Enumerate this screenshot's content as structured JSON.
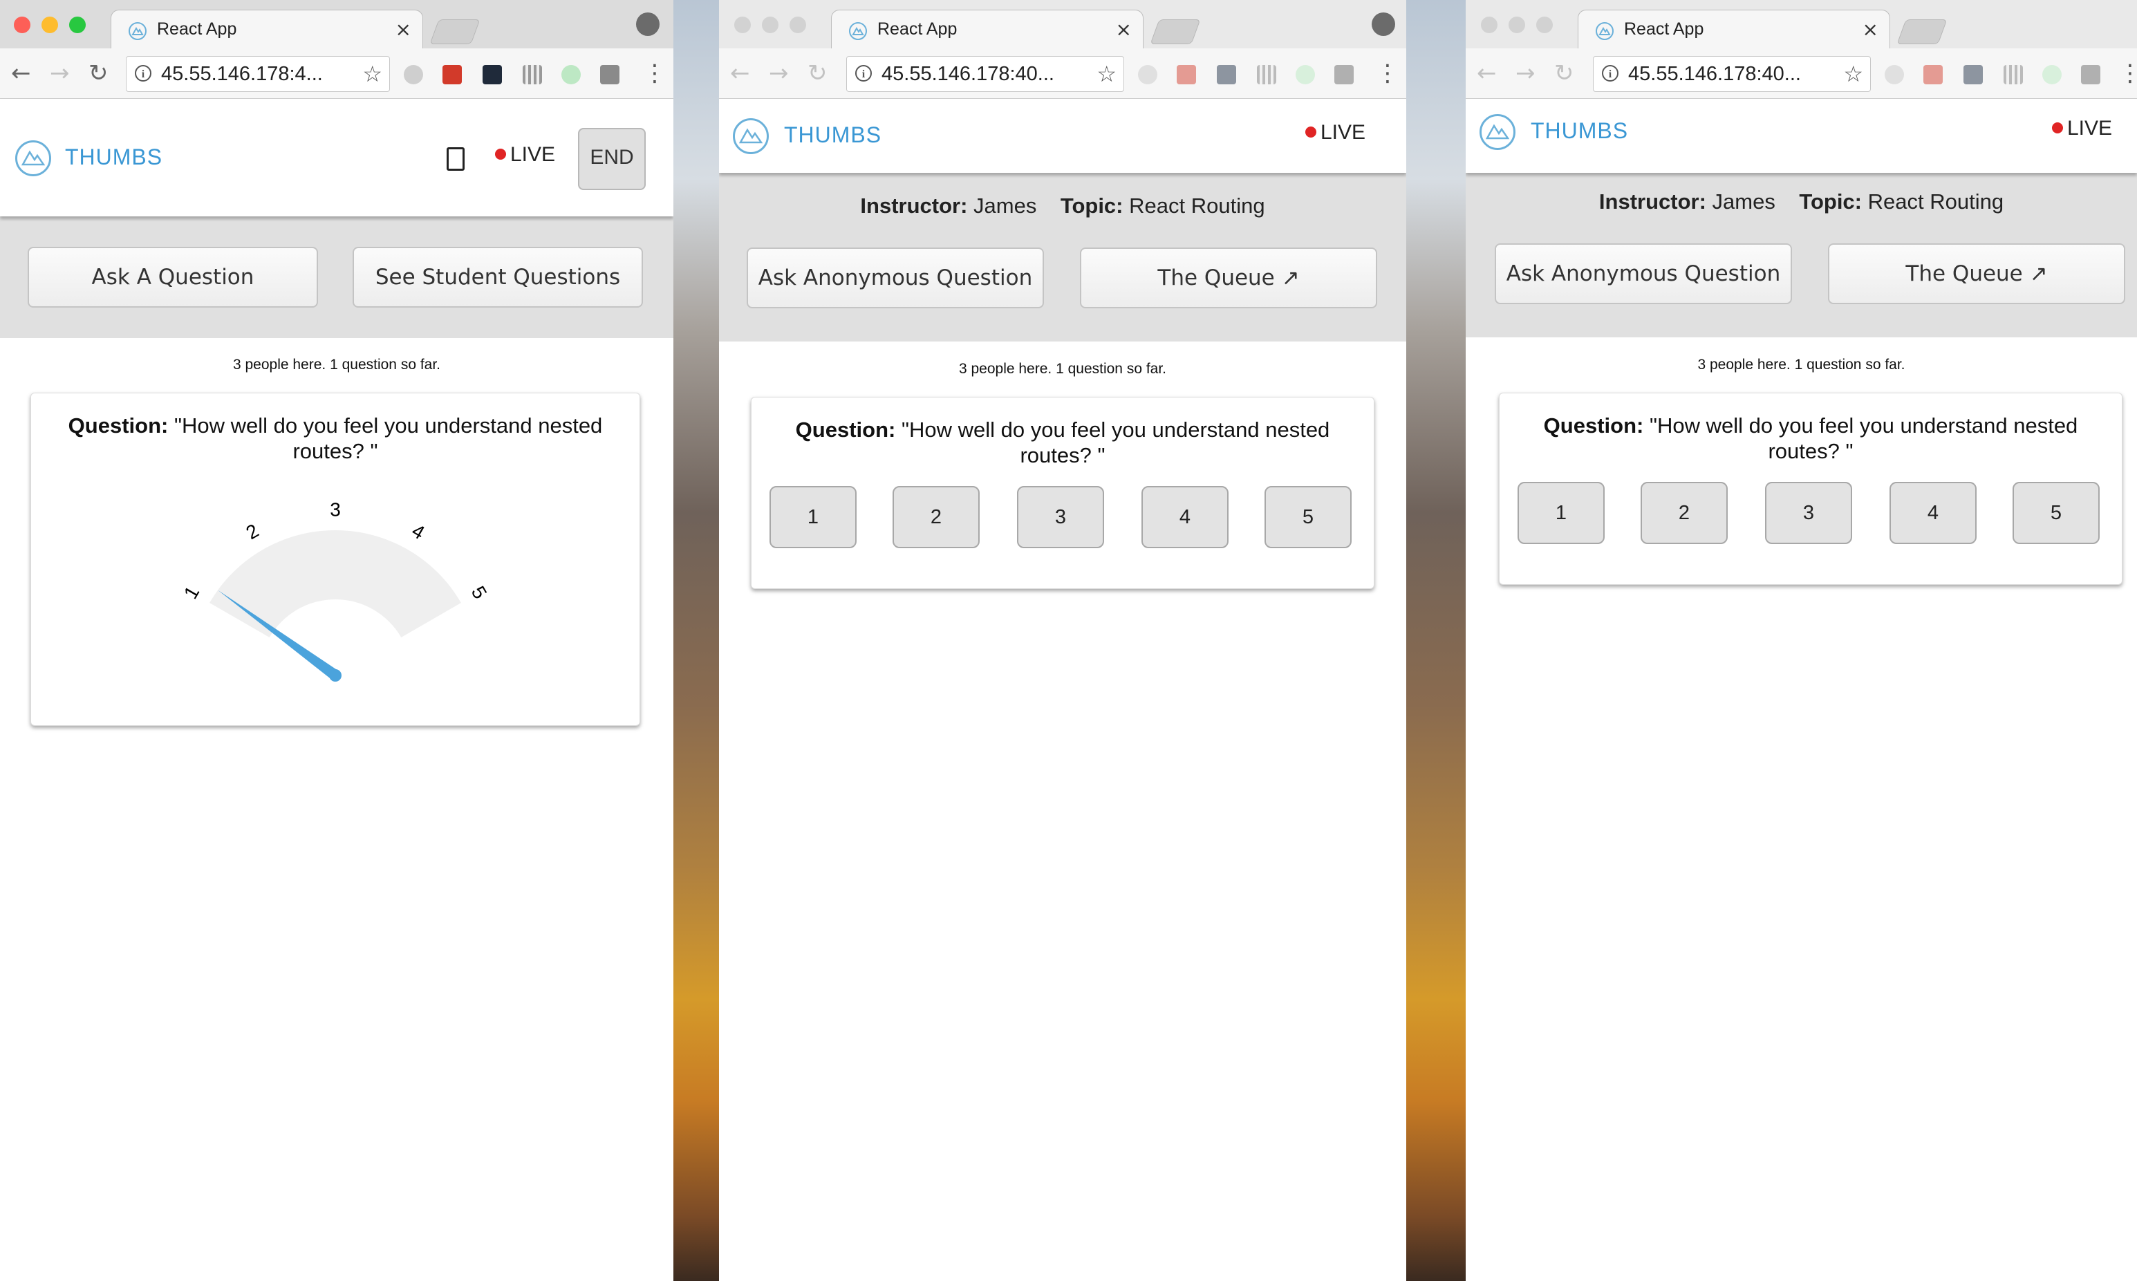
{
  "browser": {
    "tab_title": "React App",
    "url_1": "45.55.146.178:4...",
    "url_2": "45.55.146.178:40...",
    "url_3": "45.55.146.178:40..."
  },
  "app": {
    "brand": "THUMBS",
    "live": "LIVE"
  },
  "instructor_view": {
    "end_label": "END",
    "ask_question": "Ask A Question",
    "see_student_questions": "See Student Questions",
    "stats": "3 people here. 1 question so far.",
    "question_label": "Question:",
    "question_text": "\"How well do you feel you understand nested routes? \"",
    "gauge": {
      "labels": [
        "1",
        "2",
        "3",
        "4",
        "5"
      ],
      "value": 1.2
    }
  },
  "student_view": {
    "instructor_label": "Instructor:",
    "instructor_name": "James",
    "topic_label": "Topic:",
    "topic_name": "React Routing",
    "ask_anonymous": "Ask Anonymous Question",
    "the_queue": "The Queue ↗",
    "stats": "3 people here. 1 question so far.",
    "question_label": "Question:",
    "question_text": "\"How well do you feel you understand nested routes? \"",
    "ratings": [
      "1",
      "2",
      "3",
      "4",
      "5"
    ]
  },
  "colors": {
    "brand": "#3a97d4",
    "live_dot": "#e02424",
    "gauge_needle": "#4ba3dc",
    "gauge_arc": "#efefef"
  }
}
